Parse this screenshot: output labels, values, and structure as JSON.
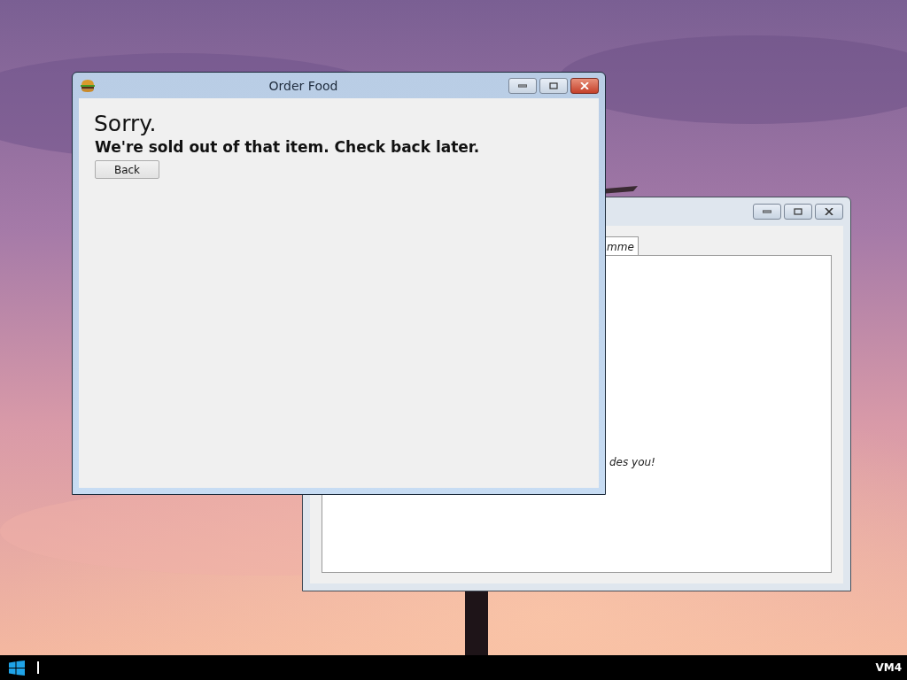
{
  "back_window": {
    "tab": {
      "label": "mme"
    },
    "text": "des you!"
  },
  "window": {
    "title": "Order Food",
    "heading": "Sorry.",
    "message": "We're sold out of that item. Check back later.",
    "buttons": [
      "Back"
    ]
  },
  "taskbar": {
    "label": "VM4"
  }
}
